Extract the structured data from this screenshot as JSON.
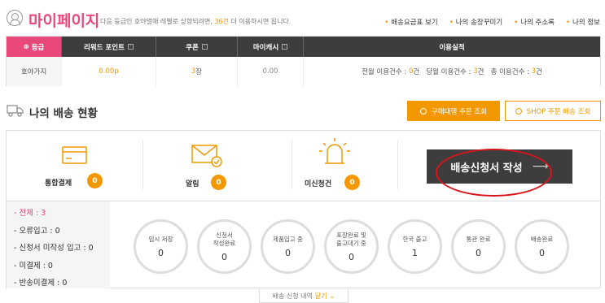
{
  "header": {
    "title": "마이페이지",
    "notice_before": "다음 등급인 호야열매 레벨로 상향되려면,",
    "notice_count": "36건",
    "notice_after": "더 이용하시면 됩니다.",
    "links": [
      "배송요금표 보기",
      "나의 송장꾸미기",
      "나의 주소록",
      "나의 정보"
    ]
  },
  "grade_table": {
    "headers": [
      "등급",
      "리워드 포인트",
      "쿠폰",
      "마이캐시",
      "이용실적"
    ],
    "grade": "호야가지",
    "reward_points": "0.00p",
    "coupon_value": "3",
    "coupon_unit": "장",
    "my_cash": "0.00",
    "usage": {
      "last_month_label": "전월 이용건수 :",
      "last_month": "0",
      "this_month_label": "당월 이용건수 :",
      "this_month": "3",
      "total_label": "총 이용건수 :",
      "total": "3",
      "unit": "건"
    }
  },
  "section": {
    "title": "나의 배송 현황",
    "btn_purchase": "구매대행 주문 조회",
    "btn_shop": "SHOP 주문 배송 조회"
  },
  "stats": [
    {
      "label": "통합결제",
      "count": "0",
      "icon": "card-icon"
    },
    {
      "label": "알림",
      "count": "0",
      "icon": "envelope-icon"
    },
    {
      "label": "미신청건",
      "count": "0",
      "icon": "siren-icon"
    }
  ],
  "write_button": "배송신청서 작성",
  "write_arrow": "⟶",
  "left_list": [
    {
      "label": "- 전체 : ",
      "value": "3"
    },
    {
      "label": "- 오류입고 : ",
      "value": "0"
    },
    {
      "label": "- 신청서 미작성 입고 : ",
      "value": "0"
    },
    {
      "label": "- 미결제 : ",
      "value": "0"
    },
    {
      "label": "- 반송미결제 : ",
      "value": "0"
    }
  ],
  "steps": [
    {
      "label": "임시 저장",
      "value": "0"
    },
    {
      "label": "신청서\n작성완료",
      "value": "0"
    },
    {
      "label": "제품입고 중",
      "value": "0"
    },
    {
      "label": "포장완료 및\n출고대기 중",
      "value": "0"
    },
    {
      "label": "한국 출고",
      "value": "1"
    },
    {
      "label": "통관 완료",
      "value": "0"
    },
    {
      "label": "배송완료",
      "value": "0"
    }
  ],
  "footer": {
    "text": "배송 신청 내역",
    "toggle": "닫기"
  },
  "colors": {
    "accent_pink": "#e8497a",
    "accent_orange": "#f39800",
    "dark": "#3d3d3d",
    "highlight_red": "#d8141b"
  }
}
